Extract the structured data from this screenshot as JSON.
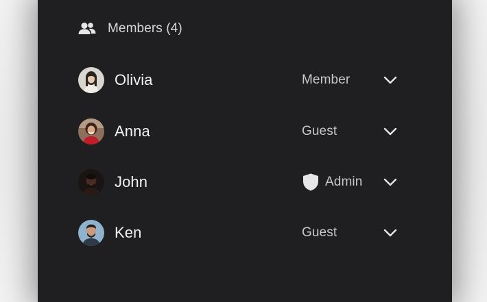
{
  "members": {
    "title": "Members (4)",
    "icon": "people-icon",
    "list": [
      {
        "name": "Olivia",
        "role": "Member",
        "role_icon": null,
        "avatar": "avatar-olivia"
      },
      {
        "name": "Anna",
        "role": "Guest",
        "role_icon": null,
        "avatar": "avatar-anna"
      },
      {
        "name": "John",
        "role": "Admin",
        "role_icon": "shield-icon",
        "avatar": "avatar-john"
      },
      {
        "name": "Ken",
        "role": "Guest",
        "role_icon": null,
        "avatar": "avatar-ken"
      }
    ]
  },
  "colors": {
    "panel_bg": "#1f1f21",
    "text_primary": "#f2f2f4",
    "text_secondary": "#c8c8ca",
    "icon": "#e6e6e8"
  }
}
